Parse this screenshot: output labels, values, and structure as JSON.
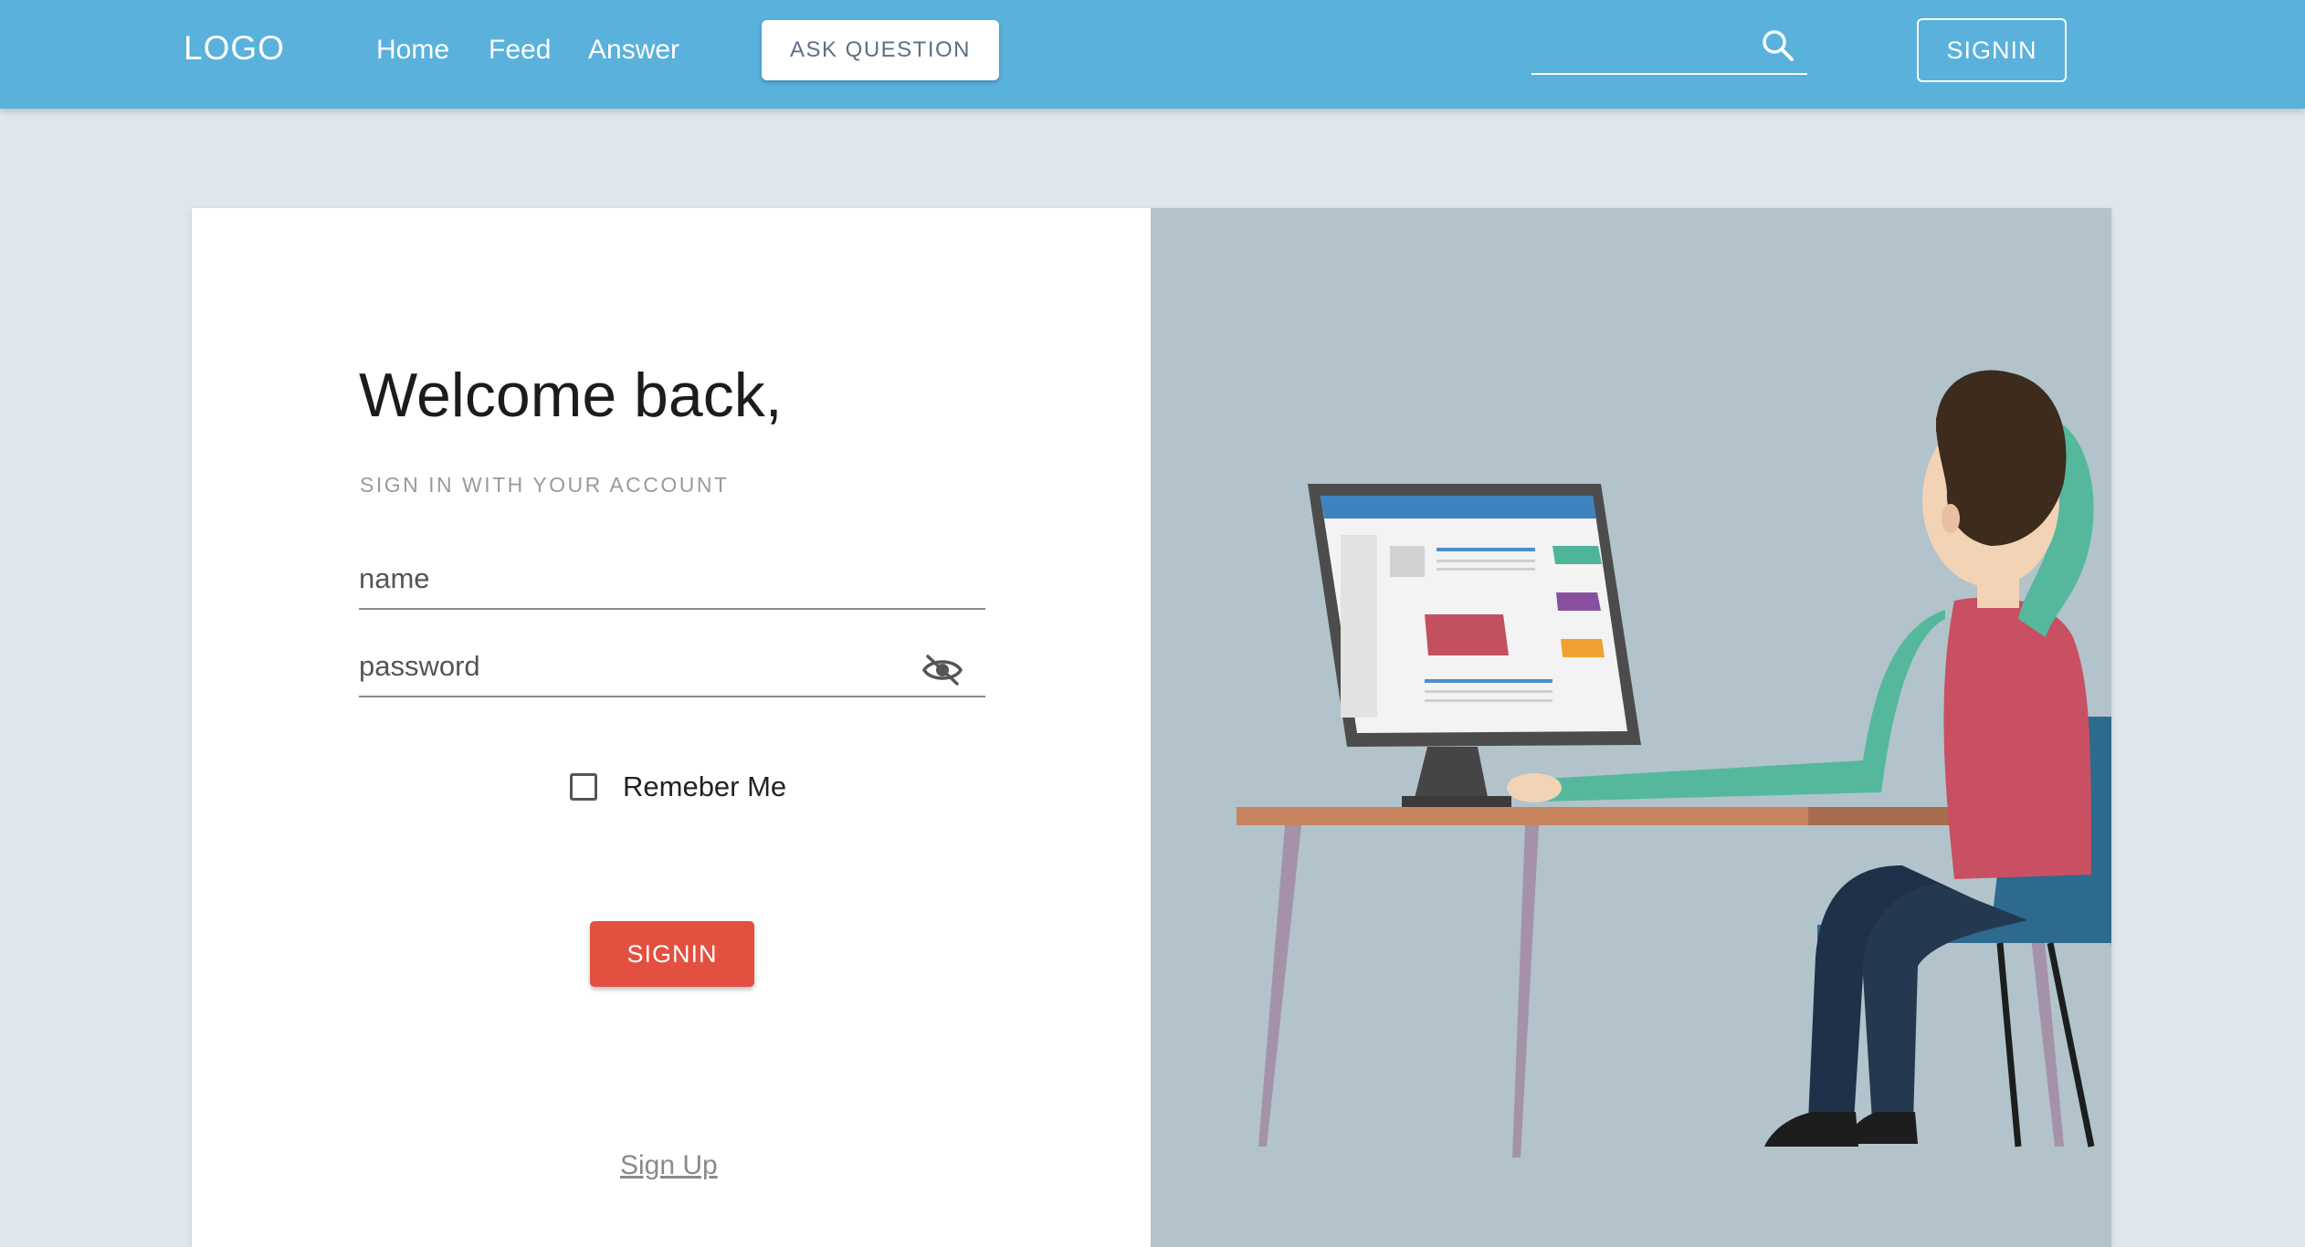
{
  "header": {
    "logo": "LOGO",
    "nav": [
      {
        "label": "Home"
      },
      {
        "label": "Feed"
      },
      {
        "label": "Answer"
      }
    ],
    "ask_button": "ASK QUESTION",
    "search": {
      "placeholder": "",
      "value": ""
    },
    "signin_button": "SIGNIN"
  },
  "login": {
    "title": "Welcome back,",
    "subtitle": "SIGN IN WITH YOUR ACCOUNT",
    "name_placeholder": "name",
    "password_placeholder": "password",
    "remember_label": "Remeber Me",
    "remember_checked": false,
    "signin_button": "SIGNIN",
    "signup_link": "Sign Up"
  },
  "colors": {
    "header_bg": "#5ab1dc",
    "page_bg": "#dfe6ed",
    "primary_button": "#e4503f",
    "illustration_bg": "#b2c3cb"
  },
  "icons": {
    "search": "search-icon",
    "password_toggle": "eye-off-icon",
    "checkbox": "checkbox-unchecked-icon"
  }
}
